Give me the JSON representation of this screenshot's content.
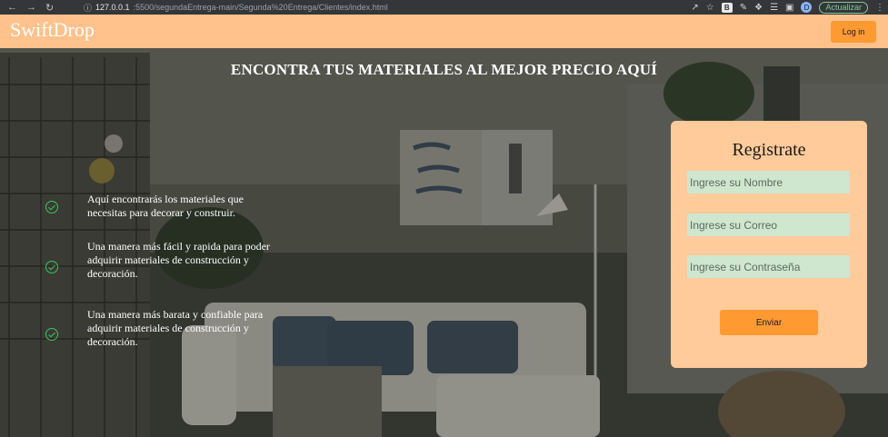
{
  "browser": {
    "back_icon": "arrow-left-icon",
    "forward_icon": "arrow-right-icon",
    "reload_icon": "reload-icon",
    "url_host": "127.0.0.1",
    "url_path": ":5500/segundaEntrega-main/Segunda%20Entrega/Clientes/index.html",
    "extension_label": "B",
    "profile_initial": "D",
    "update_label": "Actualizar"
  },
  "header": {
    "brand": "SwiftDrop",
    "login_label": "Log in",
    "background_color": "#ffc28c",
    "button_color": "#ff9a33"
  },
  "hero": {
    "title": "ENCONTRA TUS MATERIALES AL MEJOR PRECIO AQUÍ",
    "features": [
      {
        "icon": "check-circle-icon",
        "text": "Aquí encontrarás los materiales que necesitas para decorar y construir."
      },
      {
        "icon": "check-circle-icon",
        "text": "Una manera más fácil y rapida para poder adquirir materiales de construcción y decoración."
      },
      {
        "icon": "check-circle-icon",
        "text": "Una manera más barata y confiable para adquirir materiales de construcción y decoración."
      }
    ]
  },
  "register": {
    "title": "Registrate",
    "name_placeholder": "Ingrese su Nombre",
    "email_placeholder": "Ingrese su Correo",
    "password_placeholder": "Ingrese su Contraseña",
    "submit_label": "Enviar",
    "card_color": "#ffcb9b",
    "input_color": "#cfe6cf"
  }
}
